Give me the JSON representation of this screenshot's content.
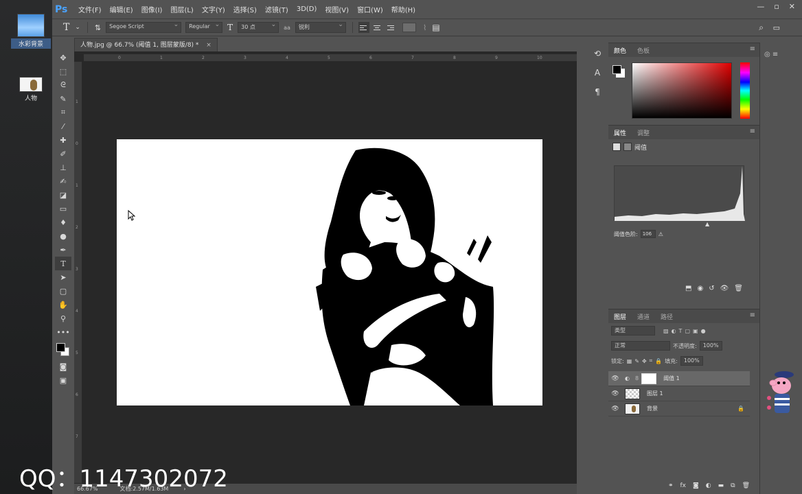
{
  "desktop": {
    "icons": [
      {
        "label": "水彩背景"
      },
      {
        "label": "人物"
      }
    ],
    "watermark": "QQ：1147302072"
  },
  "app": {
    "logo": "Ps",
    "menus": [
      "文件(F)",
      "编辑(E)",
      "图像(I)",
      "图层(L)",
      "文字(Y)",
      "选择(S)",
      "滤镜(T)",
      "3D(D)",
      "视图(V)",
      "窗口(W)",
      "帮助(H)"
    ],
    "window_controls": [
      "minimize",
      "maximize",
      "close"
    ]
  },
  "options_bar": {
    "font_family": "Segoe Script",
    "font_style": "Regular",
    "font_size": "30 点",
    "antialias_label": "aa",
    "antialias": "锐利",
    "text_color": "#6e6e6e"
  },
  "document": {
    "tab_title": "人物.jpg @ 66.7% (阈值 1, 图层蒙版/8) *",
    "zoom": "66.67%",
    "file_info": "文档:2.57M/1.63M",
    "ruler_h": [
      "0",
      "1",
      "2",
      "3",
      "4",
      "5",
      "6",
      "7",
      "8",
      "9",
      "10"
    ],
    "ruler_v": [
      "1",
      "0",
      "1",
      "2",
      "3",
      "4",
      "5",
      "6",
      "7"
    ]
  },
  "panels": {
    "color": {
      "tabs": [
        "颜色",
        "色板"
      ]
    },
    "properties": {
      "tabs": [
        "属性",
        "调整"
      ],
      "title": "阈值",
      "threshold_label": "阈值色阶:",
      "threshold_value": "106"
    },
    "layers": {
      "tabs": [
        "图层",
        "通道",
        "路径"
      ],
      "filter": "类型",
      "blend_mode": "正常",
      "opacity_label": "不透明度:",
      "opacity": "100%",
      "lock_label": "锁定:",
      "fill_label": "填充:",
      "fill": "100%",
      "items": [
        {
          "name": "阈值 1",
          "selected": true
        },
        {
          "name": "图层 1",
          "selected": false
        },
        {
          "name": "背景",
          "selected": false,
          "locked": true
        }
      ]
    }
  }
}
